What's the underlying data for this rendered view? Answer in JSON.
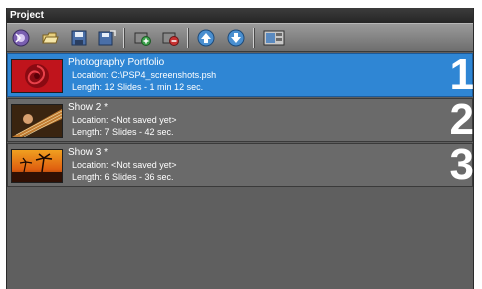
{
  "panel": {
    "title": "Project"
  },
  "toolbar": {
    "buttons": [
      {
        "icon": "new-project-icon"
      },
      {
        "icon": "open-project-icon"
      },
      {
        "icon": "save-icon"
      },
      {
        "icon": "save-as-icon"
      },
      {
        "icon": "add-show-icon"
      },
      {
        "icon": "remove-show-icon"
      },
      {
        "icon": "move-up-icon"
      },
      {
        "icon": "move-down-icon"
      },
      {
        "icon": "show-properties-icon"
      }
    ]
  },
  "shows": [
    {
      "name": "Photography Portfolio",
      "location": "Location: C:\\PSP4_screenshots.psh",
      "length": "Length: 12 Slides - 1 min 12 sec.",
      "number": "1",
      "selected": true,
      "thumb": "red-rose"
    },
    {
      "name": "Show 2 *",
      "location": "Location: <Not saved yet>",
      "length": "Length: 7 Slides - 42 sec.",
      "number": "2",
      "selected": false,
      "thumb": "guitar"
    },
    {
      "name": "Show 3 *",
      "location": "Location: <Not saved yet>",
      "length": "Length: 6 Slides - 36 sec.",
      "number": "3",
      "selected": false,
      "thumb": "sunset-palms"
    }
  ]
}
